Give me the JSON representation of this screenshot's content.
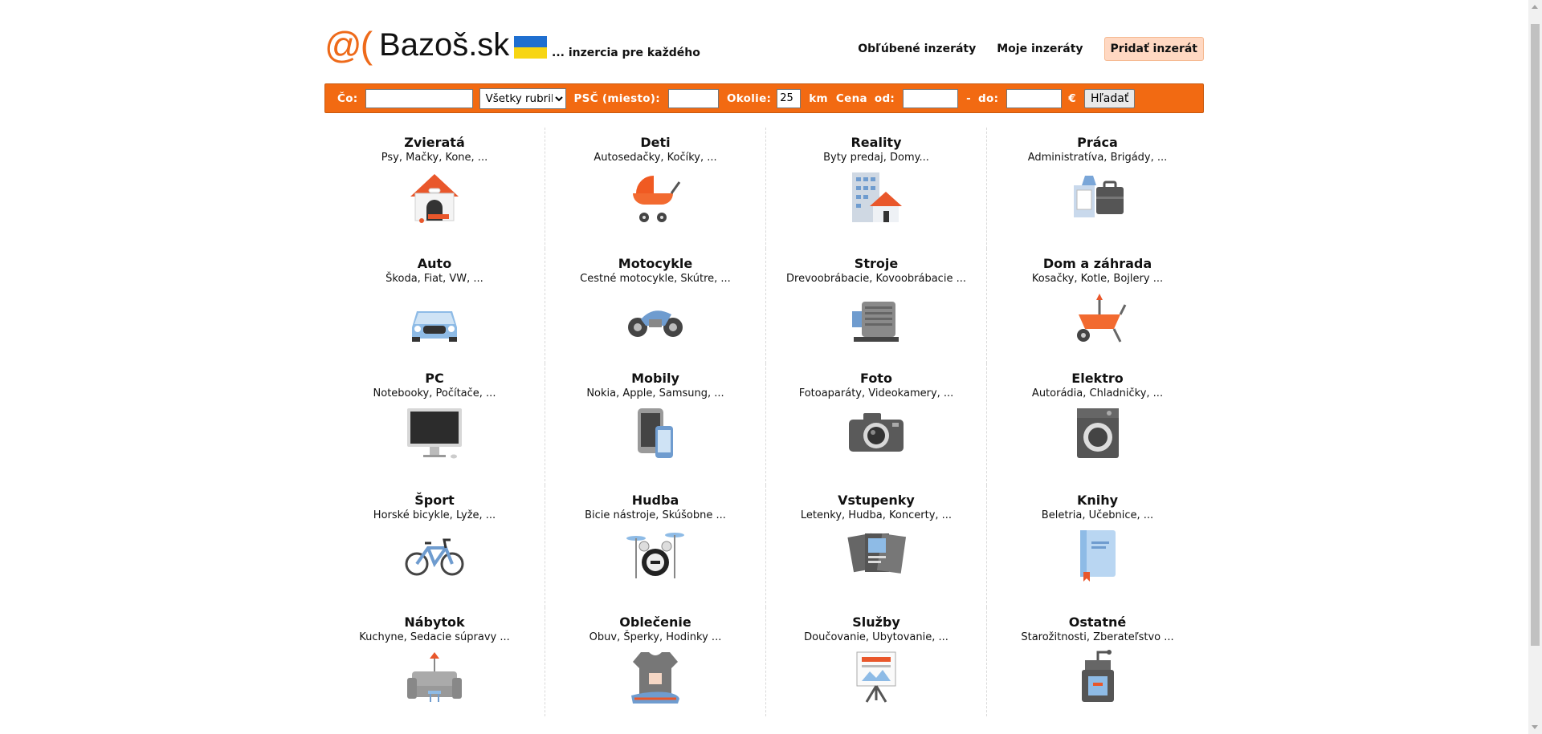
{
  "header": {
    "logo_at": "@(",
    "logo_name": "Bazoš.sk",
    "slogan": "... inzercia pre každého",
    "links": {
      "favorites": "Obľúbené inzeráty",
      "mine": "Moje inzeráty",
      "add": "Pridať inzerát"
    },
    "flag_colors": [
      "#1f6fd0",
      "#f7d512"
    ]
  },
  "search": {
    "what_label": "Čo:",
    "what_value": "",
    "category_selected": "Všetky rubriky",
    "zip_label": "PSČ (miesto):",
    "zip_value": "",
    "radius_label": "Okolie:",
    "radius_value": "25",
    "radius_unit": "km",
    "price_label": "Cena",
    "from_label": "od:",
    "from_value": "",
    "dash": "-",
    "to_label": "do:",
    "to_value": "",
    "currency": "€",
    "button": "Hľadať",
    "accent": "#f26a12"
  },
  "categories": [
    {
      "title": "Zvieratá",
      "sub": "Psy, Mačky, Kone, ...",
      "icon": "doghouse-icon"
    },
    {
      "title": "Deti",
      "sub": "Autosedačky, Kočíky, ...",
      "icon": "stroller-icon"
    },
    {
      "title": "Reality",
      "sub": "Byty predaj, Domy...",
      "icon": "buildings-icon"
    },
    {
      "title": "Práca",
      "sub": "Administratíva, Brigády, ...",
      "icon": "briefcase-icon"
    },
    {
      "title": "Auto",
      "sub": "Škoda, Fiat, VW, ...",
      "icon": "car-icon"
    },
    {
      "title": "Motocykle",
      "sub": "Cestné motocykle, Skútre, ...",
      "icon": "motorcycle-icon"
    },
    {
      "title": "Stroje",
      "sub": "Drevoobrábacie, Kovoobrábacie ...",
      "icon": "machine-icon"
    },
    {
      "title": "Dom a záhrada",
      "sub": "Kosačky, Kotle, Bojlery ...",
      "icon": "wheelbarrow-icon"
    },
    {
      "title": "PC",
      "sub": "Notebooky, Počítače, ...",
      "icon": "monitor-icon"
    },
    {
      "title": "Mobily",
      "sub": "Nokia, Apple, Samsung, ...",
      "icon": "phones-icon"
    },
    {
      "title": "Foto",
      "sub": "Fotoaparáty, Videokamery, ...",
      "icon": "camera-icon"
    },
    {
      "title": "Elektro",
      "sub": "Autorádia, Chladničky, ...",
      "icon": "washing-machine-icon"
    },
    {
      "title": "Šport",
      "sub": "Horské bicykle, Lyže, ...",
      "icon": "bicycle-icon"
    },
    {
      "title": "Hudba",
      "sub": "Bicie nástroje, Skúšobne ...",
      "icon": "drums-icon"
    },
    {
      "title": "Vstupenky",
      "sub": "Letenky, Hudba, Koncerty, ...",
      "icon": "tickets-icon"
    },
    {
      "title": "Knihy",
      "sub": "Beletria, Učebnice, ...",
      "icon": "book-icon"
    },
    {
      "title": "Nábytok",
      "sub": "Kuchyne, Sedacie súpravy ...",
      "icon": "sofa-icon"
    },
    {
      "title": "Oblečenie",
      "sub": "Obuv, Šperky, Hodinky ...",
      "icon": "tshirt-icon"
    },
    {
      "title": "Služby",
      "sub": "Doučovanie, Ubytovanie, ...",
      "icon": "easel-icon"
    },
    {
      "title": "Ostatné",
      "sub": "Starožitnosti, Zberateľstvo ...",
      "icon": "coffee-grinder-icon"
    }
  ]
}
